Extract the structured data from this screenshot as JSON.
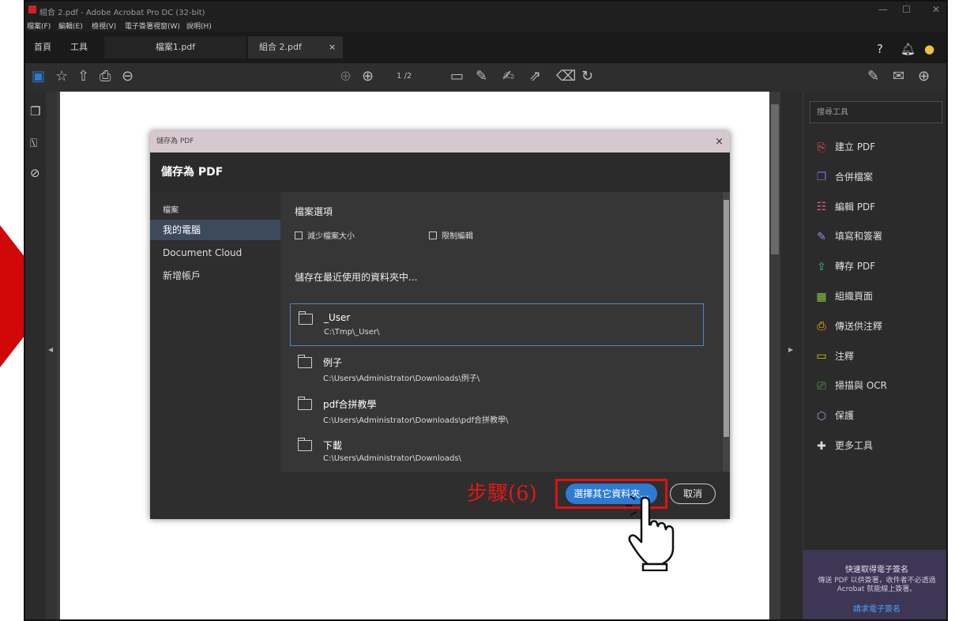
{
  "window": {
    "title": "組合 2.pdf - Adobe Acrobat Pro DC (32-bit)",
    "min": "—",
    "max": "☐",
    "close": "✕"
  },
  "menu": [
    "檔案(F)",
    "編輯(E)",
    "檢視(V)",
    "電子簽署",
    "視窗(W)",
    "說明(H)"
  ],
  "tabs": {
    "home": "首頁",
    "tools": "工具",
    "doc1": "檔案1.pdf",
    "doc2": "組合 2.pdf",
    "close": "×"
  },
  "toolbar": {
    "page_current": "1",
    "page_total": "/2"
  },
  "right_panel": {
    "search_placeholder": "搜尋工具",
    "tools": [
      {
        "label": "建立 PDF",
        "icon": "create-pdf-icon",
        "color": "#e0524a",
        "glyph": "⎘"
      },
      {
        "label": "合併檔案",
        "icon": "combine-files-icon",
        "color": "#7a6fd8",
        "glyph": "❐"
      },
      {
        "label": "編輯 PDF",
        "icon": "edit-pdf-icon",
        "color": "#e55a9a",
        "glyph": "☷"
      },
      {
        "label": "填寫和簽署",
        "icon": "fill-sign-icon",
        "color": "#9b8ae0",
        "glyph": "✎"
      },
      {
        "label": "轉存 PDF",
        "icon": "export-pdf-icon",
        "color": "#30b8a0",
        "glyph": "⇪"
      },
      {
        "label": "組織頁面",
        "icon": "organize-pages-icon",
        "color": "#8ec63f",
        "glyph": "▦"
      },
      {
        "label": "傳送供注釋",
        "icon": "send-comments-icon",
        "color": "#f2c200",
        "glyph": "⎙"
      },
      {
        "label": "注釋",
        "icon": "comment-icon",
        "color": "#f2c200",
        "glyph": "▭"
      },
      {
        "label": "掃描與 OCR",
        "icon": "scan-ocr-icon",
        "color": "#4fb848",
        "glyph": "⎚"
      },
      {
        "label": "保護",
        "icon": "protect-icon",
        "color": "#8fa0e0",
        "glyph": "⬡"
      },
      {
        "label": "更多工具",
        "icon": "more-tools-icon",
        "color": "#dddddd",
        "glyph": "✚"
      }
    ],
    "promo": {
      "title": "快速取得電子簽名",
      "body": "傳送 PDF 以供簽署，收件者不必透過 Acrobat 就能線上簽署。",
      "link": "請求電子簽名"
    }
  },
  "dialog": {
    "titlebar": "儲存為 PDF",
    "close": "×",
    "heading": "儲存為 PDF",
    "left_items": [
      "檔案",
      "我的電腦",
      "Document Cloud",
      "新增帳戶"
    ],
    "options_title": "檔案選項",
    "checkbox_reduce": "減少檔案大小",
    "checkbox_restrict": "限制編輯",
    "recent_label": "儲存在最近使用的資料夾中...",
    "folders": [
      {
        "name": "_User",
        "path": "C:\\Tmp\\_User\\"
      },
      {
        "name": "例子",
        "path": "C:\\Users\\Administrator\\Downloads\\例子\\"
      },
      {
        "name": "pdf合拼教學",
        "path": "C:\\Users\\Administrator\\Downloads\\pdf合拼教學\\"
      },
      {
        "name": "下載",
        "path": "C:\\Users\\Administrator\\Downloads\\"
      }
    ],
    "choose_other": "選擇其它資料夾...",
    "cancel": "取消"
  },
  "annotation": {
    "step_label": "步驟(6)"
  },
  "colors": {
    "accent": "#2d7ad2",
    "highlight": "#e01010",
    "pink_titlebar": "#d7c8d0"
  }
}
